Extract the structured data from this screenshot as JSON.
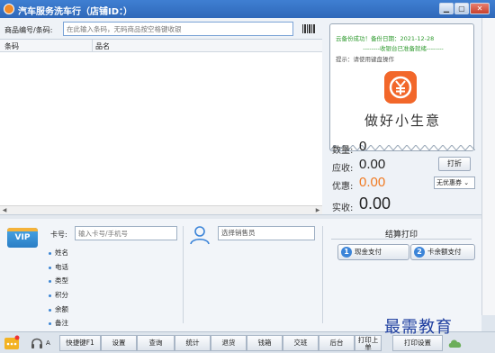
{
  "window": {
    "title": "汽车服务洗车行（店铺ID：）",
    "controls": [
      "▁",
      "▢",
      "✕"
    ]
  },
  "search": {
    "label": "商品编号/条码:",
    "placeholder": "在此输入条码，无码商品按空格键收银"
  },
  "grid": {
    "columns": [
      "条码",
      "品名"
    ],
    "rows": []
  },
  "receipt": {
    "line1": "云备份成功！备份日期：2021-12-28",
    "line2": "--------收银台已准备就绪--------",
    "line3": "提示：请使用键盘操作",
    "slogan": "做好小生意"
  },
  "summary": {
    "quantity_label": "数量:",
    "quantity_value": "0",
    "receivable_label": "应收:",
    "receivable_value": "0.00",
    "discount_label": "优惠:",
    "discount_value": "0.00",
    "paid_label": "实收:",
    "paid_value": "0.00",
    "discount_button": "打折",
    "coupon_select": "无优惠券"
  },
  "member": {
    "vip_label": "VIP",
    "card_label": "卡号:",
    "card_placeholder": "输入卡号/手机号",
    "fields": [
      "姓名",
      "电话",
      "类型",
      "积分",
      "余额",
      "备注"
    ],
    "salesperson_placeholder": "选择销售员"
  },
  "checkout": {
    "title": "结算打印",
    "cash_num": "1",
    "cash_label": "现金支付",
    "card_num": "2",
    "card_label": "卡余额支付"
  },
  "toolbar": {
    "user_label": "A",
    "buttons": [
      "快捷键F1",
      "设置",
      "查询",
      "统计",
      "退货",
      "钱箱",
      "交班",
      "后台",
      "打印上单"
    ],
    "right_label": "打印设置"
  },
  "watermark": "最需教育",
  "colors": {
    "title_bar": "#2f68b9",
    "accent_orange": "#f07a22",
    "success_green": "#2e9a2e",
    "pay_badge": "#3b84d8"
  }
}
